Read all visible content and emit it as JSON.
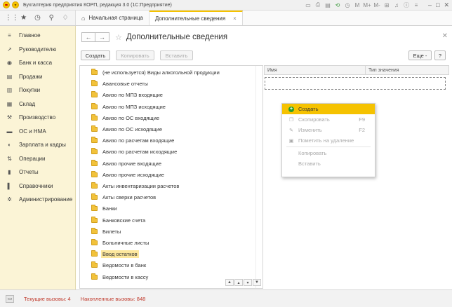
{
  "window": {
    "title": "Бухгалтерия предприятия КОРП, редакция 3.0  (1С:Предприятие)"
  },
  "tabs": [
    {
      "label": "Начальная страница"
    },
    {
      "label": "Дополнительные сведения"
    }
  ],
  "sidebar": {
    "items": [
      {
        "label": "Главное",
        "icon": "menu-icon"
      },
      {
        "label": "Руководителю",
        "icon": "trend-icon"
      },
      {
        "label": "Банк и касса",
        "icon": "bank-icon"
      },
      {
        "label": "Продажи",
        "icon": "cart-icon"
      },
      {
        "label": "Покупки",
        "icon": "basket-icon"
      },
      {
        "label": "Склад",
        "icon": "warehouse-icon"
      },
      {
        "label": "Производство",
        "icon": "factory-icon"
      },
      {
        "label": "ОС и НМА",
        "icon": "truck-icon"
      },
      {
        "label": "Зарплата и кадры",
        "icon": "people-icon"
      },
      {
        "label": "Операции",
        "icon": "operations-icon"
      },
      {
        "label": "Отчеты",
        "icon": "chart-icon"
      },
      {
        "label": "Справочники",
        "icon": "book-icon"
      },
      {
        "label": "Администрирование",
        "icon": "gear-icon"
      }
    ]
  },
  "main": {
    "title": "Дополнительные сведения",
    "toolbar": {
      "create": "Создать",
      "copy": "Копировать",
      "paste": "Вставить",
      "more": "Еще -",
      "help": "?"
    },
    "tree": [
      "(не используется) Виды алкогольной продукции",
      "Авансовые отчеты",
      "Авизо по МПЗ входящие",
      "Авизо по МПЗ исходящие",
      "Авизо по ОС входящие",
      "Авизо по ОС исходящие",
      "Авизо по расчетам входящие",
      "Авизо по расчетам исходящие",
      "Авизо прочие входящие",
      "Авизо прочие исходящие",
      "Акты инвентаризации расчетов",
      "Акты сверки расчетов",
      "Банки",
      "Банковские счета",
      "Билеты",
      "Больничные листы",
      "Ввод остатков",
      "Ведомости в банк",
      "Ведомости в кассу"
    ],
    "selected_index": 16,
    "grid": {
      "col_name": "Имя",
      "col_type": "Тип значения"
    }
  },
  "context_menu": {
    "items": [
      {
        "label": "Создать",
        "key": "",
        "state": "highlighted"
      },
      {
        "label": "Скопировать",
        "key": "F9",
        "state": "disabled"
      },
      {
        "label": "Изменить",
        "key": "F2",
        "state": "disabled"
      },
      {
        "label": "Пометить на удаление",
        "key": "",
        "state": "disabled"
      },
      {
        "label": "Копировать",
        "key": "",
        "state": "disabled"
      },
      {
        "label": "Вставить",
        "key": "",
        "state": "disabled"
      }
    ]
  },
  "status": {
    "current": "Текущие вызовы: 4",
    "accumulated": "Накопленные вызовы: 848"
  },
  "colors": {
    "accent": "#f5c200",
    "sidebar_bg": "#fbf4d6",
    "status_text": "#c0392b",
    "selection": "#fde79d"
  }
}
